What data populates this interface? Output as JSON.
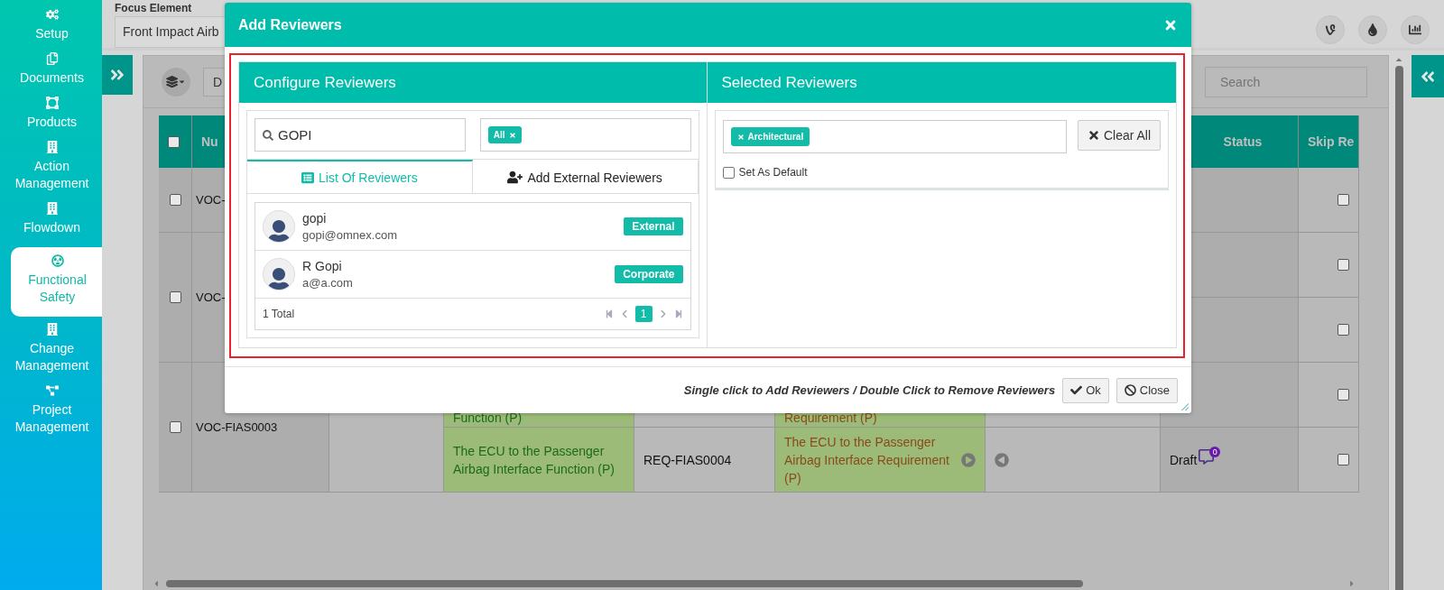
{
  "sidebar": {
    "items": [
      {
        "label": "Setup",
        "selected": false
      },
      {
        "label": "Documents",
        "selected": false
      },
      {
        "label": "Products",
        "selected": false
      },
      {
        "label": "Action Management",
        "selected": false
      },
      {
        "label": "Flowdown",
        "selected": false
      },
      {
        "label": "Functional Safety",
        "selected": true
      },
      {
        "label": "Change Management",
        "selected": false
      },
      {
        "label": "Project Management",
        "selected": false
      }
    ]
  },
  "focus_element": {
    "label": "Focus Element",
    "value": "Front Impact Airb"
  },
  "toolbar": {
    "view_dropdown": "D",
    "search": {
      "placeholder": "Search"
    }
  },
  "table": {
    "select_all": {
      "checked": false
    },
    "columns": [
      "Nu",
      "",
      "",
      "",
      "",
      "",
      "Status",
      "Skip Re"
    ],
    "rows": [
      {
        "checked": false,
        "number": "VOC-",
        "subrows": [
          {
            "skip_review": false
          }
        ]
      },
      {
        "checked": false,
        "number": "VOC-",
        "subrows": [
          {
            "skip_review": false
          },
          {
            "skip_review": false
          }
        ]
      },
      {
        "checked": false,
        "number": "VOC-FIAS0003",
        "subrows": [
          {
            "function": "Function (P)",
            "requirement": "Requirement (P)",
            "skip_review": false
          },
          {
            "function": "The ECU to the Passenger Airbag Interface Function (P)",
            "requirement_id": "REQ-FIAS0004",
            "requirement": "The ECU to the Passenger Airbag Interface Requirement (P)",
            "status": "Draft",
            "comments": "0",
            "skip_review": false
          }
        ]
      }
    ]
  },
  "dialog": {
    "title": "Add Reviewers",
    "left_panel": {
      "title": "Configure Reviewers",
      "search": {
        "value": "GOPI"
      },
      "filter_tags": [
        "All"
      ],
      "tabs": [
        {
          "label": "List Of Reviewers",
          "selected": true
        },
        {
          "label": "Add External Reviewers",
          "selected": false
        }
      ],
      "reviewers": [
        {
          "name": "gopi",
          "email": "gopi@omnex.com",
          "type": "External"
        },
        {
          "name": "R Gopi",
          "email": "a@a.com",
          "type": "Corporate"
        }
      ],
      "total": "1 Total",
      "pages": [
        {
          "label": "1",
          "selected": true
        }
      ]
    },
    "right_panel": {
      "title": "Selected Reviewers",
      "tags": [
        "Architectural"
      ],
      "clear_button": "Clear All",
      "set_default": {
        "label": "Set As Default",
        "checked": false
      }
    },
    "hint": "Single click to Add Reviewers / Double Click to Remove Reviewers",
    "buttons": [
      "Ok",
      "Close"
    ]
  }
}
